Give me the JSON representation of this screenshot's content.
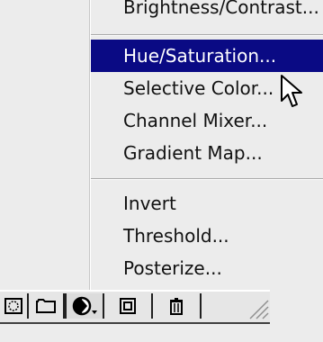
{
  "menu": {
    "partial_item": "Brightness/Contrast...",
    "items_group1": [
      {
        "label": "Hue/Saturation...",
        "selected": true
      },
      {
        "label": "Selective Color..."
      },
      {
        "label": "Channel Mixer..."
      },
      {
        "label": "Gradient Map..."
      }
    ],
    "items_group2": [
      {
        "label": "Invert"
      },
      {
        "label": "Threshold..."
      },
      {
        "label": "Posterize..."
      }
    ],
    "selection_color": "#0a0a84"
  },
  "toolbar": {
    "buttons": [
      {
        "icon": "mask-icon"
      },
      {
        "icon": "new-set-folder-icon"
      },
      {
        "icon": "adjustment-layer-icon",
        "pressed": true
      },
      {
        "icon": "new-layer-icon"
      },
      {
        "icon": "trash-icon"
      }
    ]
  }
}
